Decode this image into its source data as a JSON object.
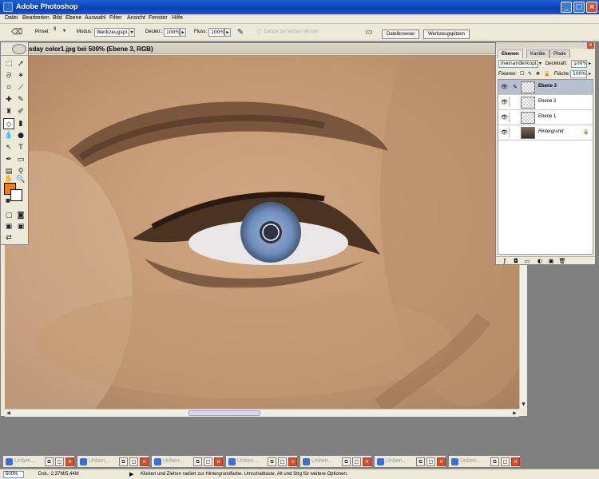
{
  "app": {
    "title": "Adobe Photoshop"
  },
  "menu": [
    "Datei",
    "Bearbeiten",
    "Bild",
    "Ebene",
    "Auswahl",
    "Filter",
    "Ansicht",
    "Fenster",
    "Hilfe"
  ],
  "options": {
    "pinsel_label": "Pinsel:",
    "pinsel_size": "9",
    "modus_label": "Modus:",
    "modus_value": "Werkzeugspi...",
    "deckkr_label": "Deckkr.:",
    "deckkr_value": "100%",
    "fluss_label": "Fluss:",
    "fluss_value": "100%",
    "history_label": "Zurück zur letzten Version",
    "tabs": [
      "Dateibrowser",
      "Werkzeugspitzen"
    ]
  },
  "document": {
    "title": "sday color1.jpg bei 500% (Ebene 3, RGB)"
  },
  "toolbox": {
    "foreground_color": "#f07f17",
    "background_color": "#ffffff"
  },
  "layers_palette": {
    "tabs": [
      "Ebenen",
      "Kanäle",
      "Pfade"
    ],
    "blend_mode": "Ineinanderkopi...",
    "opacity_label": "Deckkraft:",
    "opacity_value": "100%",
    "lock_label": "Fixieren:",
    "fill_label": "Fläche:",
    "fill_value": "100%",
    "layers": [
      {
        "name": "Ebene 3",
        "active": true
      },
      {
        "name": "Ebene 2",
        "active": false
      },
      {
        "name": "Ebene 1",
        "active": false
      },
      {
        "name": "Hintergrund",
        "active": false,
        "locked": true
      }
    ]
  },
  "minimized_windows": [
    "Unben...",
    "Unben...",
    "Unben...",
    "Unben...",
    "Unben...",
    "Unben...",
    "Unben..."
  ],
  "status": {
    "zoom": "500%",
    "doc_info": "Dok.: 2,37M/5,44M",
    "hint": "Klicken und Ziehen radiert zur Hintergrundfarbe. Umschalttaste, Alt und Strg für weitere Optionen."
  }
}
